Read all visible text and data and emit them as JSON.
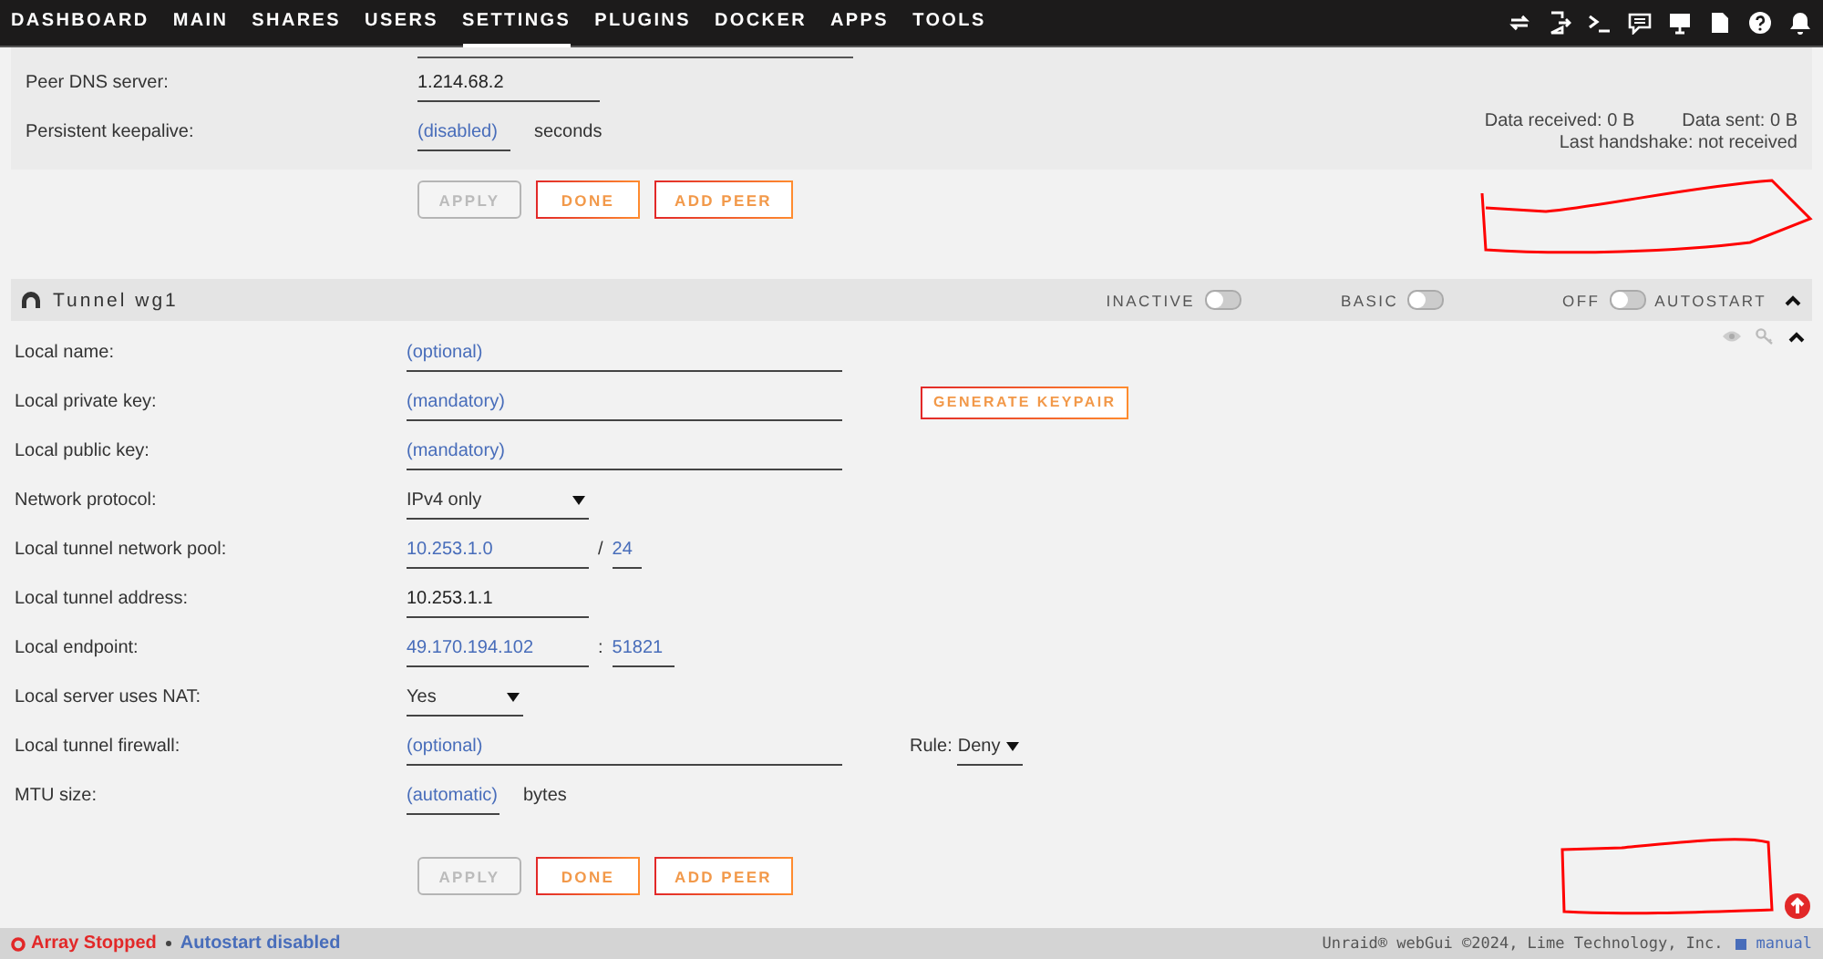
{
  "nav": {
    "items": [
      {
        "label": "DASHBOARD",
        "selected": false
      },
      {
        "label": "MAIN",
        "selected": false
      },
      {
        "label": "SHARES",
        "selected": false
      },
      {
        "label": "USERS",
        "selected": false
      },
      {
        "label": "SETTINGS",
        "selected": true
      },
      {
        "label": "PLUGINS",
        "selected": false
      },
      {
        "label": "DOCKER",
        "selected": false
      },
      {
        "label": "APPS",
        "selected": false
      },
      {
        "label": "TOOLS",
        "selected": false
      }
    ]
  },
  "peer_panel": {
    "rows": [
      {
        "label": "Peer DNS server:",
        "kind": "short",
        "value": "1.214.68.2"
      },
      {
        "label": "Persistent keepalive:",
        "kind": "unit",
        "placeholder": "(disabled)",
        "unit": "seconds",
        "stats": {
          "received": "Data received: 0 B",
          "sent": "Data sent: 0 B",
          "handshake": "Last handshake: not received"
        }
      }
    ],
    "buttons": [
      {
        "label": "APPLY",
        "disabled": true
      },
      {
        "label": "DONE",
        "disabled": false
      },
      {
        "label": "ADD PEER",
        "disabled": false
      }
    ]
  },
  "tunnel": {
    "title": "Tunnel wg1",
    "toggles": [
      {
        "label": "INACTIVE",
        "on": false
      },
      {
        "label": "BASIC",
        "on": false
      },
      {
        "label": "OFF",
        "on": false,
        "suffix": "AUTOSTART"
      }
    ],
    "rows": [
      {
        "label": "Local name:",
        "kind": "text",
        "placeholder": "(optional)"
      },
      {
        "label": "Local private key:",
        "kind": "text",
        "placeholder": "(mandatory)",
        "action": "GENERATE KEYPAIR"
      },
      {
        "label": "Local public key:",
        "kind": "text",
        "placeholder": "(mandatory)"
      },
      {
        "label": "Network protocol:",
        "kind": "select",
        "value": "IPv4 only"
      },
      {
        "label": "Local tunnel network pool:",
        "kind": "pair",
        "placeholder": "10.253.1.0",
        "separator": "/",
        "second_placeholder": "24"
      },
      {
        "label": "Local tunnel address:",
        "kind": "short",
        "value": "10.253.1.1"
      },
      {
        "label": "Local endpoint:",
        "kind": "pair",
        "placeholder": "49.170.194.102",
        "separator": ":",
        "second_placeholder": "51821"
      },
      {
        "label": "Local server uses NAT:",
        "kind": "select",
        "value": "Yes"
      },
      {
        "label": "Local tunnel firewall:",
        "kind": "text",
        "placeholder": "(optional)",
        "rule": {
          "label": "Rule:",
          "value": "Deny"
        }
      },
      {
        "label": "MTU size:",
        "kind": "unit",
        "placeholder": "(automatic)",
        "unit": "bytes"
      }
    ],
    "buttons": [
      {
        "label": "APPLY",
        "disabled": true
      },
      {
        "label": "DONE",
        "disabled": false
      },
      {
        "label": "ADD PEER",
        "disabled": false
      }
    ]
  },
  "footer": {
    "status": "Array Stopped",
    "autostart": "Autostart disabled",
    "copyright": "Unraid® webGui ©2024, Lime Technology, Inc.",
    "manual": "manual"
  }
}
